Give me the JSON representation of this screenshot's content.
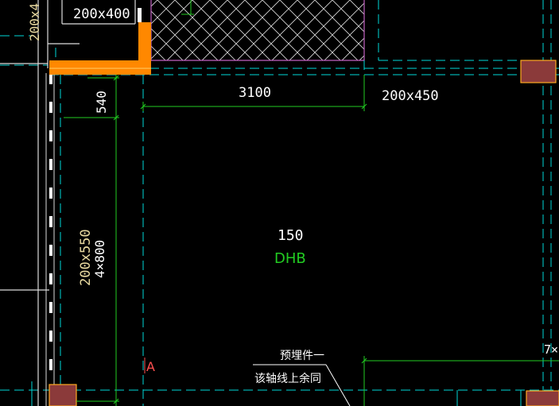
{
  "drawing": {
    "colors": {
      "background": "#000000",
      "axis_dashed": "#00d8d8",
      "dimension": "#22cc22",
      "wall": "#dcdcdc",
      "column_fill": "#8b3a3a",
      "column_edge": "#ffaa22",
      "highlight_beam": "#ff8800",
      "hatch": "#dddddd",
      "hatch_frame": "#c060c0"
    },
    "labels": {
      "beam_top": "200x400",
      "left_vertical_cut": "200x4",
      "dim_3100": "3100",
      "beam_right": "200x450",
      "dim_540": "540",
      "beam_left_1": "200x550",
      "beam_left_2": "4×800",
      "slab_thickness": "150",
      "slab_type": "DHB",
      "axis_marker": "A",
      "note_line1": "预埋件一",
      "note_line2": "该轴线上余同",
      "edge_right": "7×"
    }
  }
}
